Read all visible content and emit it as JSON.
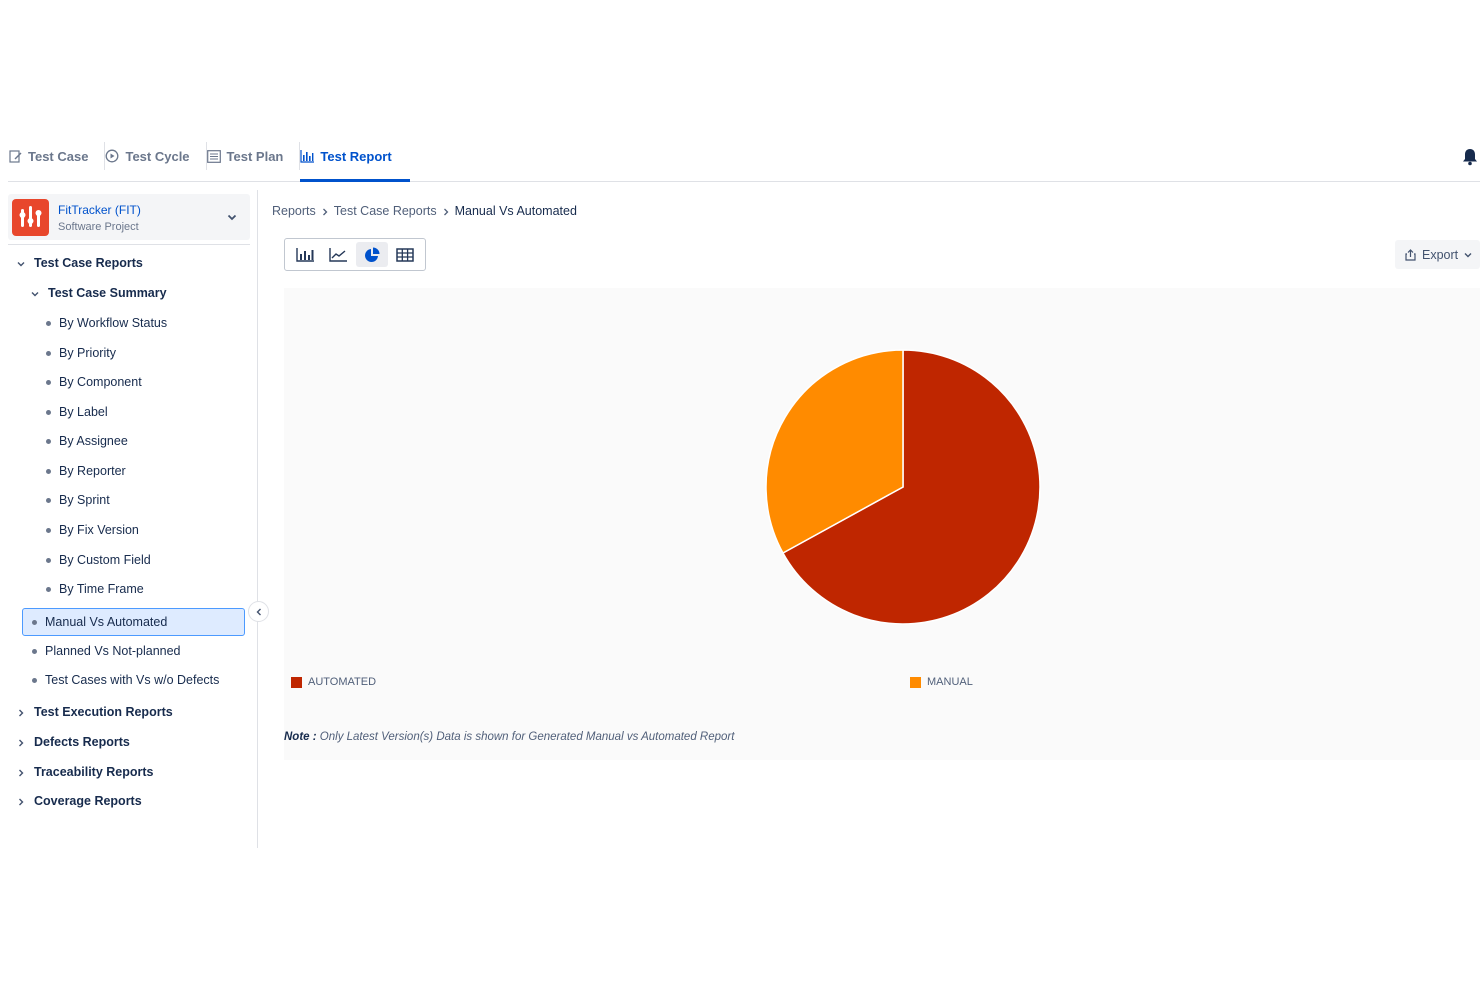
{
  "tabs": [
    {
      "label": "Test Case",
      "icon": "edit-icon"
    },
    {
      "label": "Test Cycle",
      "icon": "cycle-icon"
    },
    {
      "label": "Test Plan",
      "icon": "list-icon"
    },
    {
      "label": "Test Report",
      "icon": "bar-chart-icon",
      "active": true
    }
  ],
  "project": {
    "name": "FitTracker (FIT)",
    "type": "Software Project",
    "logo_color": "#e8472c"
  },
  "sidebar": {
    "test_case_reports": "Test Case Reports",
    "test_case_summary": "Test Case Summary",
    "summary_items": [
      "By Workflow Status",
      "By Priority",
      "By Component",
      "By Label",
      "By Assignee",
      "By Reporter",
      "By Sprint",
      "By Fix Version",
      "By Custom Field",
      "By Time Frame"
    ],
    "report_items": [
      "Manual Vs Automated",
      "Planned Vs Not-planned",
      "Test Cases with Vs w/o Defects"
    ],
    "sections": [
      "Test Execution Reports",
      "Defects Reports",
      "Traceability Reports",
      "Coverage Reports"
    ]
  },
  "breadcrumb": {
    "items": [
      "Reports",
      "Test Case Reports"
    ],
    "current": "Manual Vs Automated"
  },
  "export_label": "Export",
  "note": {
    "label": "Note :",
    "text": "Only Latest Version(s) Data is shown for Generated Manual vs Automated Report"
  },
  "colors": {
    "accent": "#0052cc",
    "automated": "#bf2600",
    "manual": "#ff8b00"
  },
  "chart_data": {
    "type": "pie",
    "categories": [
      "AUTOMATED",
      "MANUAL"
    ],
    "values": [
      67,
      33
    ],
    "colors": [
      "#bf2600",
      "#ff8b00"
    ],
    "legend_position": "bottom"
  }
}
